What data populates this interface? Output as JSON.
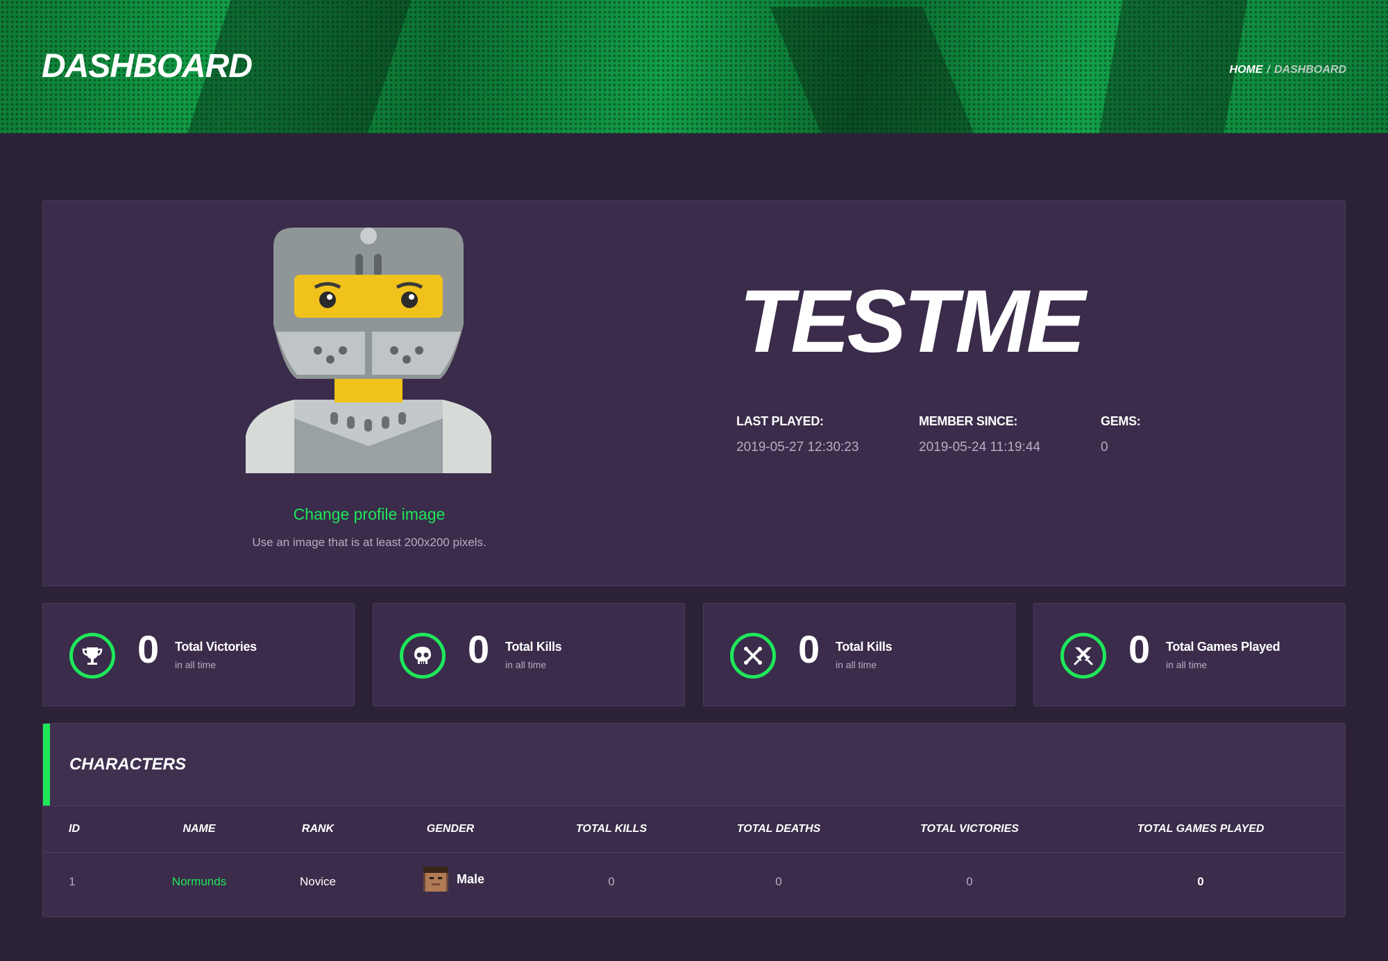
{
  "header": {
    "title": "DASHBOARD",
    "breadcrumb": {
      "home": "HOME",
      "separator": "/",
      "current": "DASHBOARD"
    }
  },
  "profile": {
    "avatar_icon": "knight-avatar-icon",
    "change_image_label": "Change profile image",
    "change_image_hint": "Use an image that is at least 200x200 pixels.",
    "username": "TESTME",
    "stats": [
      {
        "label": "LAST PLAYED:",
        "value": "2019-05-27 12:30:23"
      },
      {
        "label": "MEMBER SINCE:",
        "value": "2019-05-24 11:19:44"
      },
      {
        "label": "GEMS:",
        "value": "0"
      }
    ]
  },
  "cards": [
    {
      "icon": "trophy-icon",
      "count": "0",
      "title": "Total Victories",
      "subtitle": "in all time"
    },
    {
      "icon": "skull-icon",
      "count": "0",
      "title": "Total Kills",
      "subtitle": "in all time"
    },
    {
      "icon": "crossed-bones-icon",
      "count": "0",
      "title": "Total Kills",
      "subtitle": "in all time"
    },
    {
      "icon": "crossed-swords-icon",
      "count": "0",
      "title": "Total Games Played",
      "subtitle": "in all time"
    }
  ],
  "characters": {
    "title": "CHARACTERS",
    "columns": [
      "ID",
      "NAME",
      "RANK",
      "GENDER",
      "TOTAL KILLS",
      "TOTAL DEATHS",
      "TOTAL VICTORIES",
      "TOTAL GAMES PLAYED"
    ],
    "rows": [
      {
        "id": "1",
        "name": "Normunds",
        "rank": "Novice",
        "gender": "Male",
        "gender_icon": "male-character-icon",
        "kills": "0",
        "deaths": "0",
        "victories": "0",
        "games_played": "0"
      }
    ]
  },
  "colors": {
    "accent": "#1ee85a",
    "background": "#2b2238",
    "panel": "#3a2c4a",
    "muted_text": "#b7aec2"
  }
}
